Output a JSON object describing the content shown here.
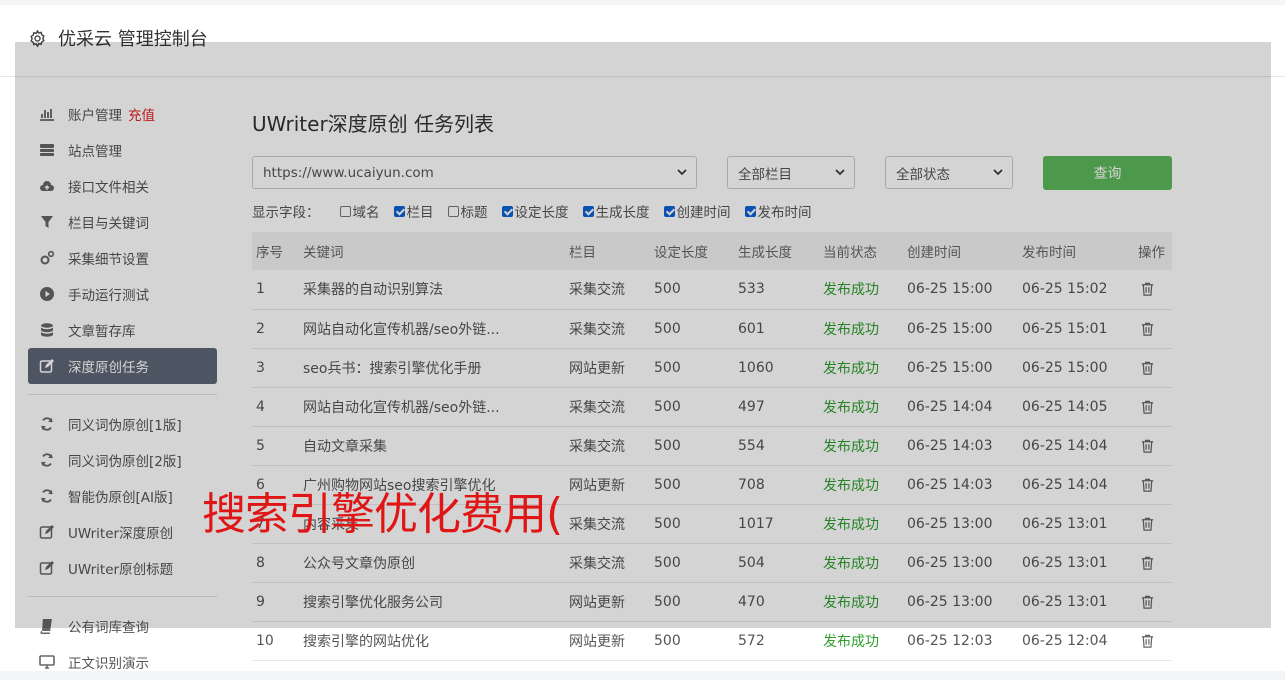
{
  "header": {
    "title": "优采云 管理控制台"
  },
  "sidebar": {
    "group1": [
      {
        "label": "账户管理",
        "icon": "bar-chart-icon",
        "extra": "充值"
      },
      {
        "label": "站点管理",
        "icon": "server-icon"
      },
      {
        "label": "接口文件相关",
        "icon": "cloud-upload-icon"
      },
      {
        "label": "栏目与关键词",
        "icon": "filter-icon"
      },
      {
        "label": "采集细节设置",
        "icon": "gears-icon"
      },
      {
        "label": "手动运行测试",
        "icon": "play-circle-icon"
      },
      {
        "label": "文章暂存库",
        "icon": "database-icon"
      },
      {
        "label": "深度原创任务",
        "icon": "edit-icon",
        "active": true
      }
    ],
    "group2": [
      {
        "label": "同义词伪原创[1版]",
        "icon": "refresh-icon"
      },
      {
        "label": "同义词伪原创[2版]",
        "icon": "refresh-icon"
      },
      {
        "label": "智能伪原创[AI版]",
        "icon": "refresh-icon"
      },
      {
        "label": "UWriter深度原创",
        "icon": "edit-icon"
      },
      {
        "label": "UWriter原创标题",
        "icon": "edit-icon"
      }
    ],
    "group3": [
      {
        "label": "公有词库查询",
        "icon": "book-icon"
      },
      {
        "label": "正文识别演示",
        "icon": "monitor-icon"
      }
    ]
  },
  "main": {
    "title": "UWriter深度原创 任务列表",
    "site_select": "https://www.ucaiyun.com",
    "column_select": "全部栏目",
    "status_select": "全部状态",
    "query_button": "查询",
    "fields_label": "显示字段：",
    "fields": [
      {
        "label": "域名",
        "checked": false
      },
      {
        "label": "栏目",
        "checked": true
      },
      {
        "label": "标题",
        "checked": false
      },
      {
        "label": "设定长度",
        "checked": true
      },
      {
        "label": "生成长度",
        "checked": true
      },
      {
        "label": "创建时间",
        "checked": true
      },
      {
        "label": "发布时间",
        "checked": true
      }
    ],
    "table": {
      "headers": [
        "序号",
        "关键词",
        "栏目",
        "设定长度",
        "生成长度",
        "当前状态",
        "创建时间",
        "发布时间",
        "操作"
      ],
      "rows": [
        [
          "1",
          "采集器的自动识别算法",
          "采集交流",
          "500",
          "533",
          "发布成功",
          "06-25 15:00",
          "06-25 15:02"
        ],
        [
          "2",
          "网站自动化宣传机器/seo外链...",
          "采集交流",
          "500",
          "601",
          "发布成功",
          "06-25 15:00",
          "06-25 15:01"
        ],
        [
          "3",
          "seo兵书：搜索引擎优化手册",
          "网站更新",
          "500",
          "1060",
          "发布成功",
          "06-25 15:00",
          "06-25 15:00"
        ],
        [
          "4",
          "网站自动化宣传机器/seo外链...",
          "采集交流",
          "500",
          "497",
          "发布成功",
          "06-25 14:04",
          "06-25 14:05"
        ],
        [
          "5",
          "自动文章采集",
          "采集交流",
          "500",
          "554",
          "发布成功",
          "06-25 14:03",
          "06-25 14:04"
        ],
        [
          "6",
          "广州购物网站seo搜索引擎优化",
          "网站更新",
          "500",
          "708",
          "发布成功",
          "06-25 14:03",
          "06-25 14:04"
        ],
        [
          "7",
          "内容采集",
          "采集交流",
          "500",
          "1017",
          "发布成功",
          "06-25 13:00",
          "06-25 13:01"
        ],
        [
          "8",
          "公众号文章伪原创",
          "采集交流",
          "500",
          "504",
          "发布成功",
          "06-25 13:00",
          "06-25 13:01"
        ],
        [
          "9",
          "搜索引擎优化服务公司",
          "网站更新",
          "500",
          "470",
          "发布成功",
          "06-25 13:00",
          "06-25 13:01"
        ],
        [
          "10",
          "搜索引擎的网站优化",
          "网站更新",
          "500",
          "572",
          "发布成功",
          "06-25 12:03",
          "06-25 12:04"
        ]
      ]
    }
  },
  "watermark": "搜索引擎优化费用(",
  "colors": {
    "active_nav": "#5e6776",
    "query_button": "#5cb85c",
    "status_success": "#2e9e2e",
    "watermark": "#e01515",
    "recharge": "#e02020"
  }
}
